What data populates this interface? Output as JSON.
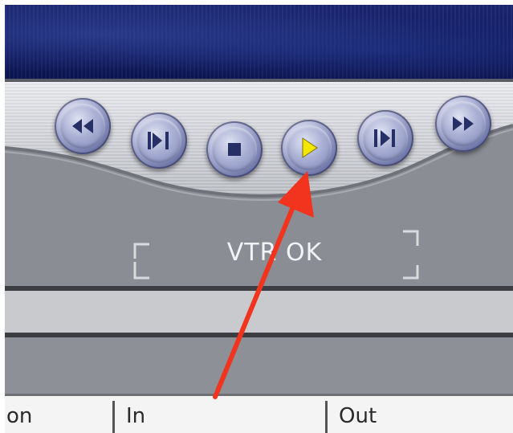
{
  "video": {
    "description_color": "#14206a"
  },
  "transport": {
    "buttons": [
      {
        "name": "rewind-button",
        "icon": "rewind-icon"
      },
      {
        "name": "previous-edit-button",
        "icon": "previous-edit-icon"
      },
      {
        "name": "stop-button",
        "icon": "stop-icon"
      },
      {
        "name": "play-button",
        "icon": "play-icon",
        "active_color": "#f3e600"
      },
      {
        "name": "next-edit-button",
        "icon": "next-edit-icon"
      },
      {
        "name": "fast-forward-button",
        "icon": "fast-forward-icon"
      }
    ]
  },
  "status": {
    "text": "VTR OK"
  },
  "columns": [
    {
      "label": "on"
    },
    {
      "label": "In"
    },
    {
      "label": "Out"
    }
  ],
  "annotation": {
    "color": "#f2331e",
    "icon": "red-arrow-icon"
  }
}
